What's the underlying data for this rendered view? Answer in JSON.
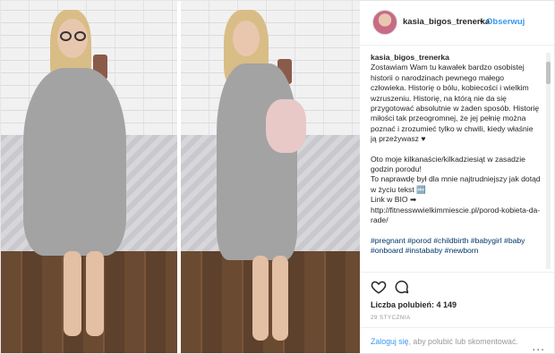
{
  "header": {
    "username": "kasia_bigos_trenerka",
    "separator": "•",
    "follow_label": "Obserwuj"
  },
  "caption": {
    "author": "kasia_bigos_trenerka",
    "paragraph1": "Zostawiam Wam tu kawałek bardzo osobistej historii o narodzinach pewnego małego człowieka. Historię o bólu, kobiecości i wielkim wzruszeniu. Historię, na którą nie da się przygotować absolutnie w żaden sposób. Historię miłości tak przeogromnej, że jej pełnię można poznać i zrozumieć tylko w chwili, kiedy właśnie ją przeżywasz ♥",
    "paragraph2": "Oto moje kilkanaście/kilkadziesiąt w zasadzie godzin porodu!\nTo naprawdę był dla mnie najtrudniejszy jak dotąd w życiu tekst 🔤\nLink w BIO ➡\nhttp://fitnesswwielkimmiescie.pl/porod-kobieta-da-rade/",
    "hashtags": "#pregnant #porod #childbirth #babygirl #baby #onboard #instababy #newborn"
  },
  "actions": {
    "likes_label": "Liczba polubień: 4 149",
    "date": "29 STYCZNIA",
    "login_link": "Zaloguj się",
    "login_rest": ", aby polubić lub skomentować.",
    "more_label": "..."
  },
  "icons": {
    "heart": "heart-icon",
    "comment": "comment-icon",
    "more": "more-options-icon"
  }
}
